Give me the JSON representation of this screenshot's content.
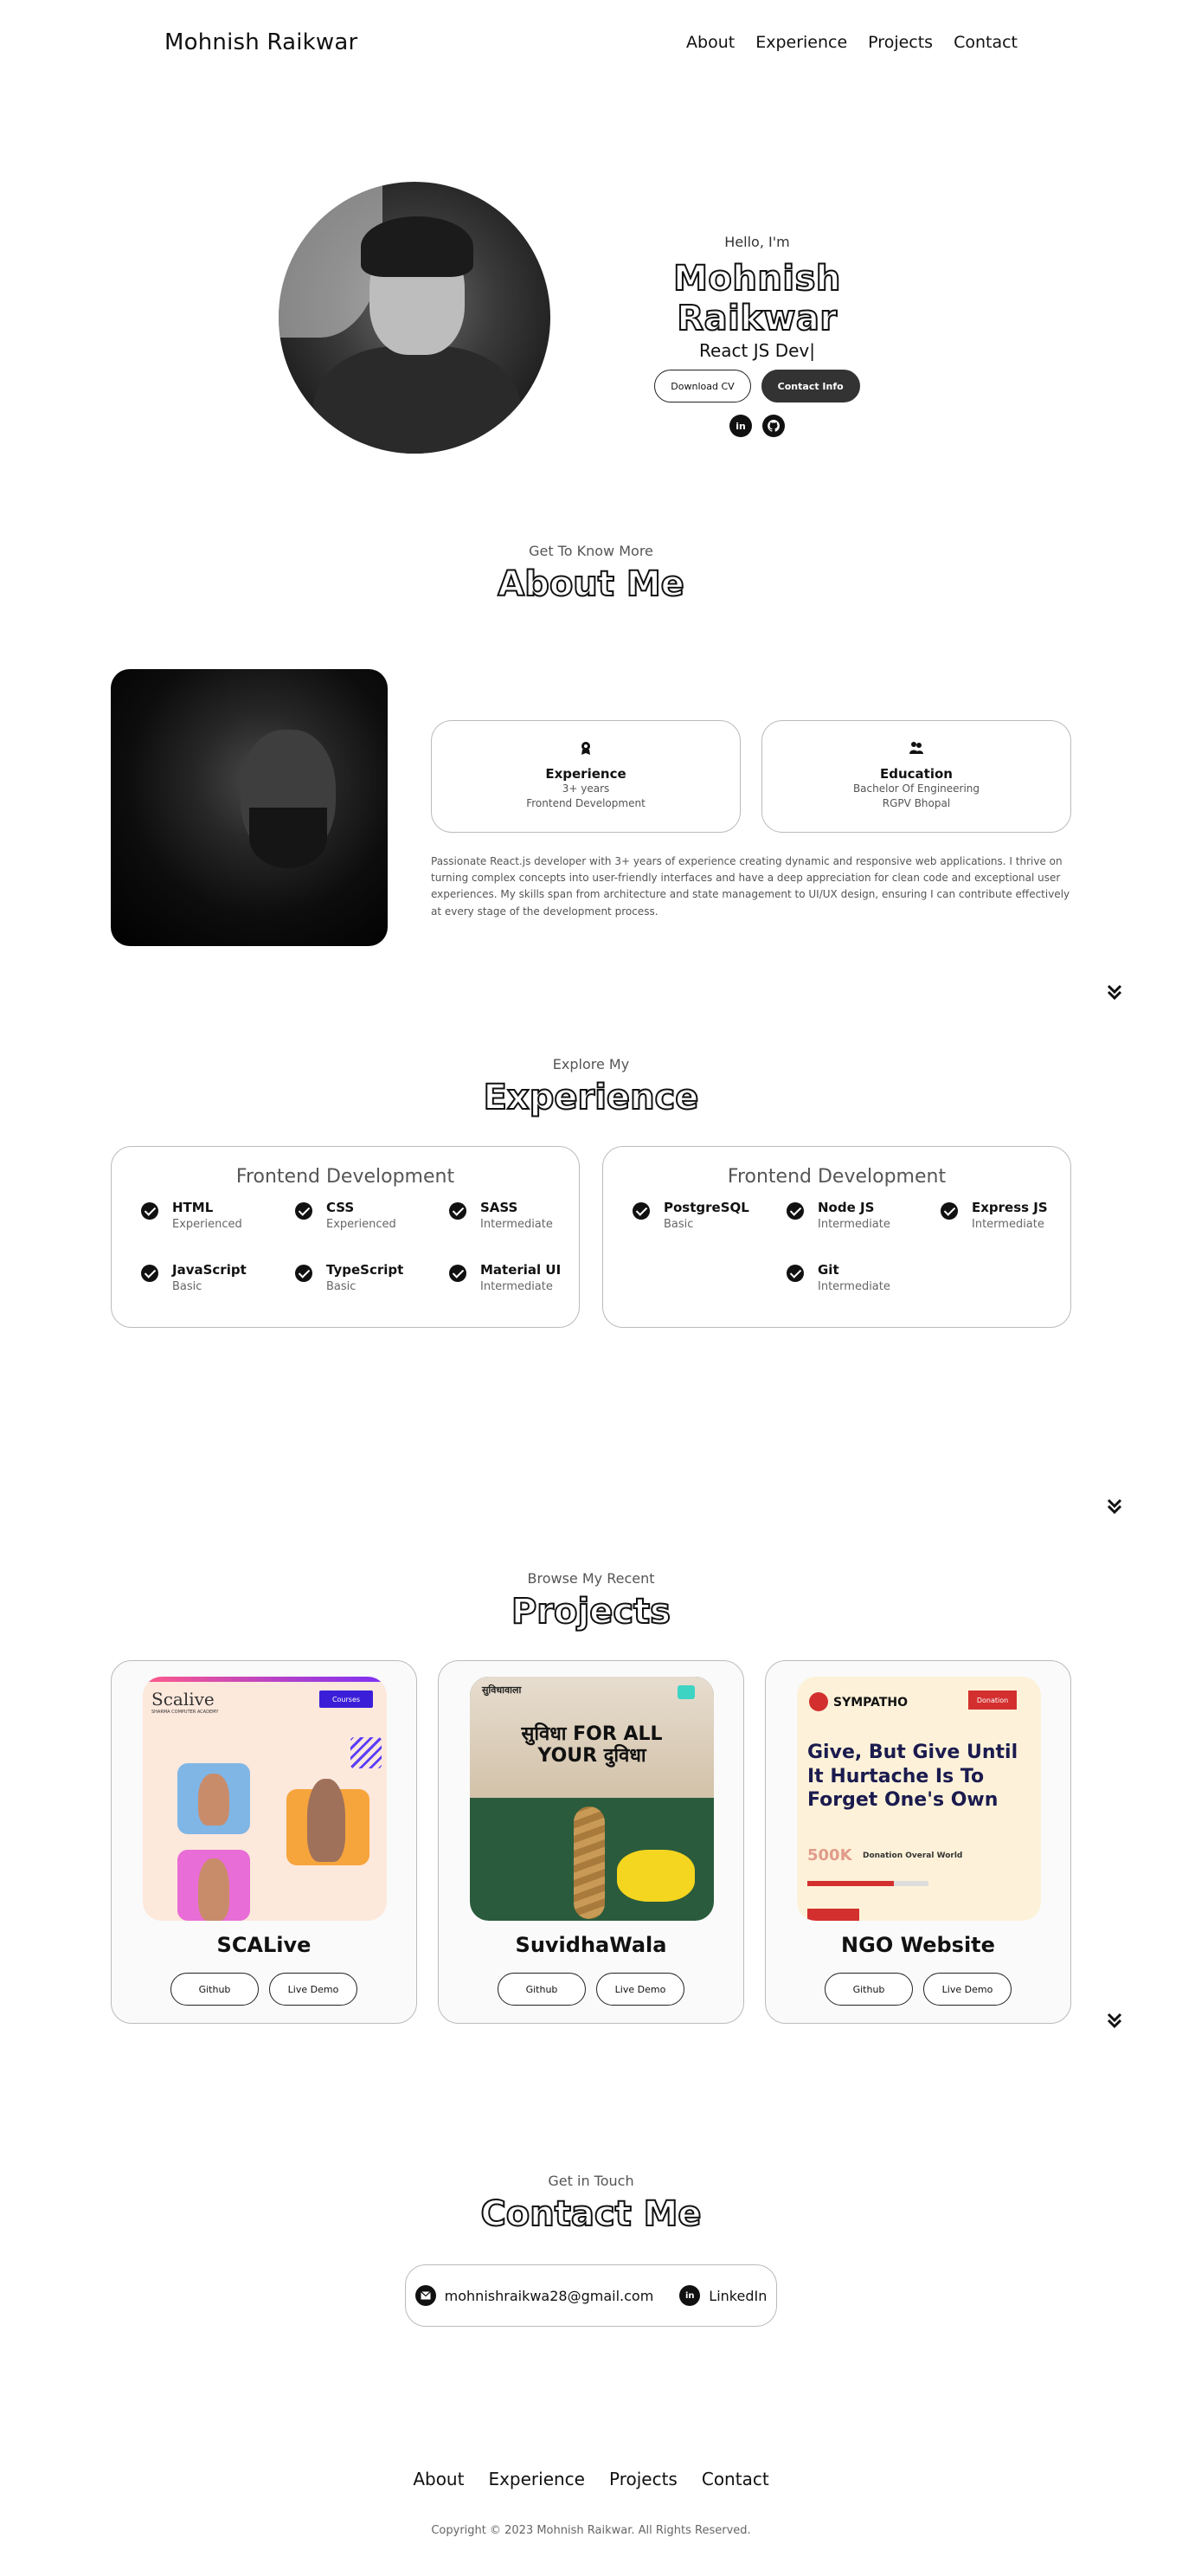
{
  "nav": {
    "brand": "Mohnish Raikwar",
    "links": [
      "About",
      "Experience",
      "Projects",
      "Contact"
    ]
  },
  "hero": {
    "greeting": "Hello, I'm",
    "name": "Mohnish Raikwar",
    "role": "React JS Dev|",
    "download_cv": "Download CV",
    "contact_info": "Contact Info",
    "socials": [
      "linkedin-icon",
      "github-icon"
    ]
  },
  "about": {
    "subtitle": "Get To Know More",
    "title": "About Me",
    "cards": [
      {
        "icon": "award-icon",
        "title": "Experience",
        "lines": [
          "3+ years",
          "Frontend Development"
        ]
      },
      {
        "icon": "education-icon",
        "title": "Education",
        "lines": [
          "Bachelor Of Engineering",
          "RGPV Bhopal"
        ]
      }
    ],
    "paragraph": "Passionate React.js developer with 3+ years of experience creating dynamic and responsive web applications. I thrive on turning complex concepts into user-friendly interfaces and have a deep appreciation for clean code and exceptional user experiences. My skills span from architecture and state management to UI/UX design, ensuring I can contribute effectively at every stage of the development process."
  },
  "experience": {
    "subtitle": "Explore My",
    "title": "Experience",
    "cards": [
      {
        "title": "Frontend Development",
        "skills": [
          {
            "name": "HTML",
            "level": "Experienced"
          },
          {
            "name": "CSS",
            "level": "Experienced"
          },
          {
            "name": "SASS",
            "level": "Intermediate"
          },
          {
            "name": "JavaScript",
            "level": "Basic"
          },
          {
            "name": "TypeScript",
            "level": "Basic"
          },
          {
            "name": "Material UI",
            "level": "Intermediate"
          }
        ]
      },
      {
        "title": "Frontend Development",
        "skills": [
          {
            "name": "PostgreSQL",
            "level": "Basic"
          },
          {
            "name": "Node JS",
            "level": "Intermediate"
          },
          {
            "name": "Express JS",
            "level": "Intermediate"
          },
          {
            "name": "Git",
            "level": "Intermediate"
          }
        ]
      }
    ]
  },
  "projects": {
    "subtitle": "Browse My Recent",
    "title": "Projects",
    "github_label": "Github",
    "demo_label": "Live Demo",
    "items": [
      {
        "title": "SCALive",
        "shot": {
          "logo": "Scalive",
          "logo_sub": "SHARMA COMPUTER ACADEMY",
          "button": "Courses"
        }
      },
      {
        "title": "SuvidhaWala",
        "shot": {
          "logo": "सुविधावाला",
          "headline": "सुविधा FOR ALL YOUR दुविधा"
        }
      },
      {
        "title": "NGO Website",
        "shot": {
          "logo": "SYMPATHO",
          "button": "Donation",
          "headline": "Give, But Give Until It Hurtache Is To Forget One's Own",
          "amount": "500K",
          "amount_sub": "Donation Overal World"
        }
      }
    ]
  },
  "contact": {
    "subtitle": "Get in Touch",
    "title": "Contact Me",
    "email": "mohnishraikwa28@gmail.com",
    "linkedin": "LinkedIn"
  },
  "footer": {
    "links": [
      "About",
      "Experience",
      "Projects",
      "Contact"
    ],
    "copyright": "Copyright © 2023 Mohnish Raikwar. All Rights Reserved."
  }
}
